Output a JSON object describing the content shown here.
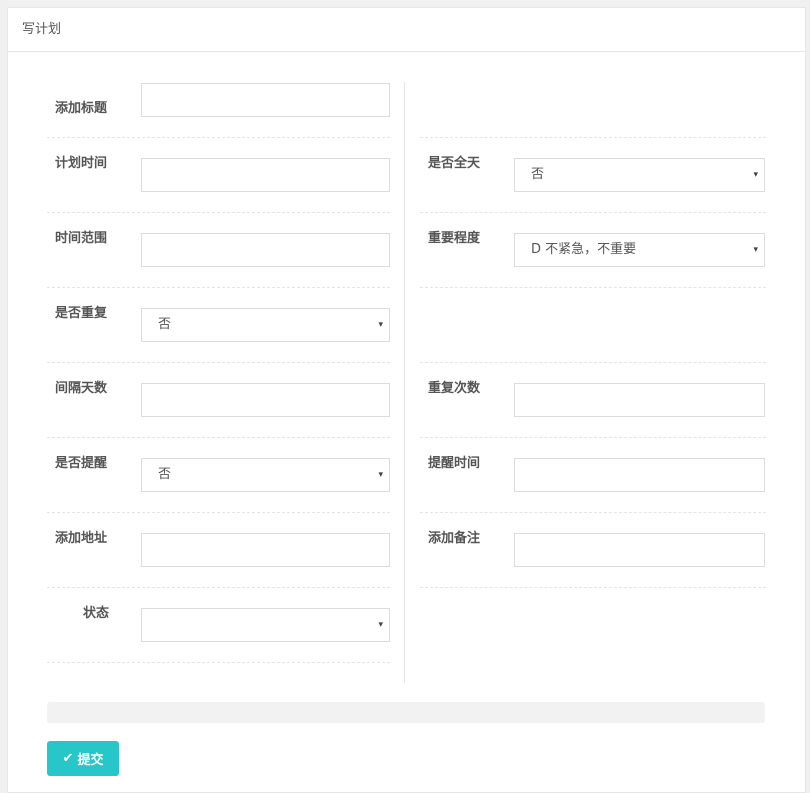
{
  "panel": {
    "title": "写计划"
  },
  "left_fields": [
    {
      "label": "添加标题",
      "type": "text",
      "value": ""
    },
    {
      "label": "计划时间",
      "type": "text",
      "value": ""
    },
    {
      "label": "时间范围",
      "type": "text",
      "value": ""
    },
    {
      "label": "是否重复",
      "type": "select",
      "value": "否"
    },
    {
      "label": "间隔天数",
      "type": "text",
      "value": ""
    },
    {
      "label": "是否提醒",
      "type": "select",
      "value": "否"
    },
    {
      "label": "添加地址",
      "type": "text",
      "value": ""
    },
    {
      "label": "状态",
      "type": "select",
      "value": ""
    }
  ],
  "right_fields": [
    {
      "label": "",
      "type": "none",
      "value": ""
    },
    {
      "label": "是否全天",
      "type": "select",
      "value": "否"
    },
    {
      "label": "重要程度",
      "type": "select",
      "value": "D 不紧急，不重要"
    },
    {
      "label": "",
      "type": "none",
      "value": ""
    },
    {
      "label": "重复次数",
      "type": "text",
      "value": ""
    },
    {
      "label": "提醒时间",
      "type": "text",
      "value": ""
    },
    {
      "label": "添加备注",
      "type": "text",
      "value": ""
    }
  ],
  "submit": {
    "label": "提交",
    "icon": "check-icon"
  },
  "colors": {
    "accent": "#26c6c9",
    "border": "#dcdcdc"
  },
  "caret_glyph": "▾"
}
